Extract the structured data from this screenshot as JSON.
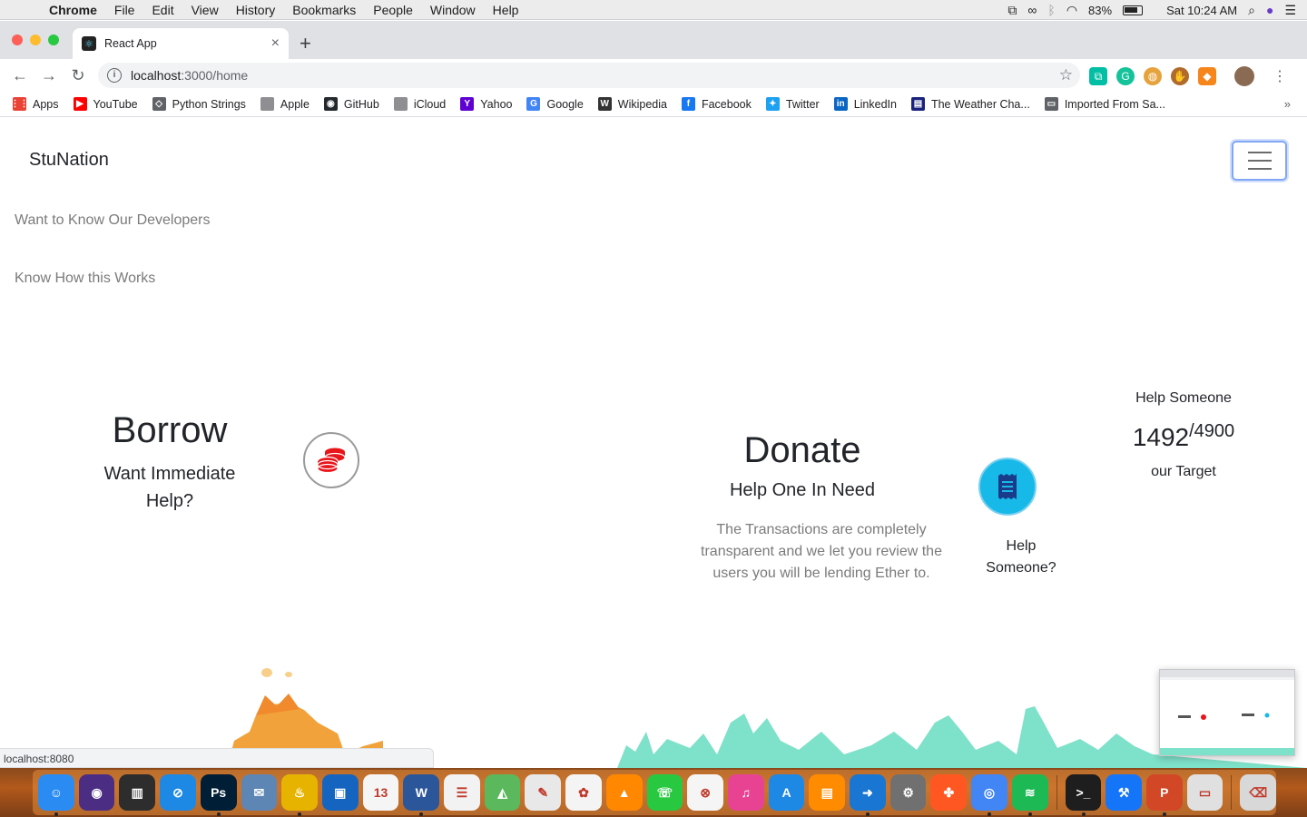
{
  "menubar": {
    "app": "Chrome",
    "items": [
      "File",
      "Edit",
      "View",
      "History",
      "Bookmarks",
      "People",
      "Window",
      "Help"
    ],
    "battery": "83%",
    "clock": "Sat 10:24 AM"
  },
  "tab": {
    "title": "React App"
  },
  "omnibox": {
    "host": "localhost",
    "path": ":3000/home"
  },
  "bookmarks": [
    {
      "label": "Apps",
      "icon": "apps-grid-icon",
      "color": "#ea4335"
    },
    {
      "label": "YouTube",
      "icon": "youtube-icon",
      "color": "#ff0000"
    },
    {
      "label": "Python Strings",
      "icon": "python-strings-icon",
      "color": "#5f6368"
    },
    {
      "label": "Apple",
      "icon": "apple-icon",
      "color": "#8e8e93"
    },
    {
      "label": "GitHub",
      "icon": "github-icon",
      "color": "#24292e"
    },
    {
      "label": "iCloud",
      "icon": "apple-icon",
      "color": "#8e8e93"
    },
    {
      "label": "Yahoo",
      "icon": "yahoo-icon",
      "color": "#5f01d1"
    },
    {
      "label": "Google",
      "icon": "google-icon",
      "color": "#4285f4"
    },
    {
      "label": "Wikipedia",
      "icon": "wikipedia-icon",
      "color": "#333333"
    },
    {
      "label": "Facebook",
      "icon": "facebook-icon",
      "color": "#1877f2"
    },
    {
      "label": "Twitter",
      "icon": "twitter-icon",
      "color": "#1da1f2"
    },
    {
      "label": "LinkedIn",
      "icon": "linkedin-icon",
      "color": "#0a66c2"
    },
    {
      "label": "The Weather Cha...",
      "icon": "weather-channel-icon",
      "color": "#1a237e"
    },
    {
      "label": "Imported From Sa...",
      "icon": "folder-icon",
      "color": "#5f6368"
    }
  ],
  "page": {
    "brand": "StuNation",
    "nav_links": [
      "Want to Know Our Developers",
      "Know How this Works"
    ],
    "borrow": {
      "title": "Borrow",
      "subtitle": "Want Immediate Help?"
    },
    "donate": {
      "title": "Donate",
      "subtitle": "Help One In Need",
      "description": "The Transactions are completely transparent and we let you review the users you will be lending Ether to.",
      "help_label": "Help Someone?"
    },
    "target": {
      "label": "Help Someone",
      "current": "1492",
      "total": "/4900",
      "footer": "our Target"
    },
    "accent_red": "#e8151b",
    "accent_blue": "#17b9e8"
  },
  "status_url": "localhost:8080",
  "dock": [
    {
      "name": "finder-icon",
      "color": "#2a8cf3",
      "label": "☺",
      "running": true
    },
    {
      "name": "siri-icon",
      "color": "#4b2e83",
      "label": "◉",
      "running": false
    },
    {
      "name": "piano-icon",
      "color": "#2d2d2d",
      "label": "▥",
      "running": false
    },
    {
      "name": "safari-icon",
      "color": "#1e88e5",
      "label": "⊘",
      "running": false
    },
    {
      "name": "photoshop-icon",
      "color": "#001e36",
      "label": "Ps",
      "running": true
    },
    {
      "name": "preview-icon",
      "color": "#5d86b5",
      "label": "✉",
      "running": false
    },
    {
      "name": "genie-icon",
      "color": "#e6b400",
      "label": "♨",
      "running": true
    },
    {
      "name": "code-editor-icon",
      "color": "#1565c0",
      "label": "▣",
      "running": false
    },
    {
      "name": "calendar-icon",
      "color": "#f5f5f5",
      "label": "13",
      "running": false
    },
    {
      "name": "word-icon",
      "color": "#2b579a",
      "label": "W",
      "running": true
    },
    {
      "name": "reminders-icon",
      "color": "#f2f2f2",
      "label": "☰",
      "running": false
    },
    {
      "name": "maps-icon",
      "color": "#5cb85c",
      "label": "◭",
      "running": false
    },
    {
      "name": "textedit-icon",
      "color": "#e8e8e8",
      "label": "✎",
      "running": false
    },
    {
      "name": "photos-icon",
      "color": "#f4f4f4",
      "label": "✿",
      "running": false
    },
    {
      "name": "vlc-icon",
      "color": "#ff8800",
      "label": "▲",
      "running": false
    },
    {
      "name": "facetime-icon",
      "color": "#28c840",
      "label": "☏",
      "running": false
    },
    {
      "name": "news-icon",
      "color": "#f5f5f5",
      "label": "⊗",
      "running": false
    },
    {
      "name": "itunes-icon",
      "color": "#e84393",
      "label": "♫",
      "running": false
    },
    {
      "name": "appstore-icon",
      "color": "#1e88e5",
      "label": "A",
      "running": false
    },
    {
      "name": "books-icon",
      "color": "#ff8c00",
      "label": "▤",
      "running": false
    },
    {
      "name": "migration-icon",
      "color": "#1976d2",
      "label": "➜",
      "running": true
    },
    {
      "name": "system-preferences-icon",
      "color": "#707070",
      "label": "⚙",
      "running": false
    },
    {
      "name": "clover-icon",
      "color": "#ff5722",
      "label": "✤",
      "running": false
    },
    {
      "name": "chrome-icon",
      "color": "#4285f4",
      "label": "◎",
      "running": true
    },
    {
      "name": "spotify-icon",
      "color": "#1db954",
      "label": "≋",
      "running": true
    },
    {
      "name": "terminal-icon",
      "color": "#1e1e1e",
      "label": ">_",
      "running": true
    },
    {
      "name": "xcode-icon",
      "color": "#1575f9",
      "label": "⚒",
      "running": false
    },
    {
      "name": "powerpoint-icon",
      "color": "#d24726",
      "label": "P",
      "running": true
    },
    {
      "name": "screenshot-icon",
      "color": "#e0e0e0",
      "label": "▭",
      "running": false
    },
    {
      "name": "trash-icon",
      "color": "#d8d8d8",
      "label": "⌫",
      "running": false
    }
  ]
}
